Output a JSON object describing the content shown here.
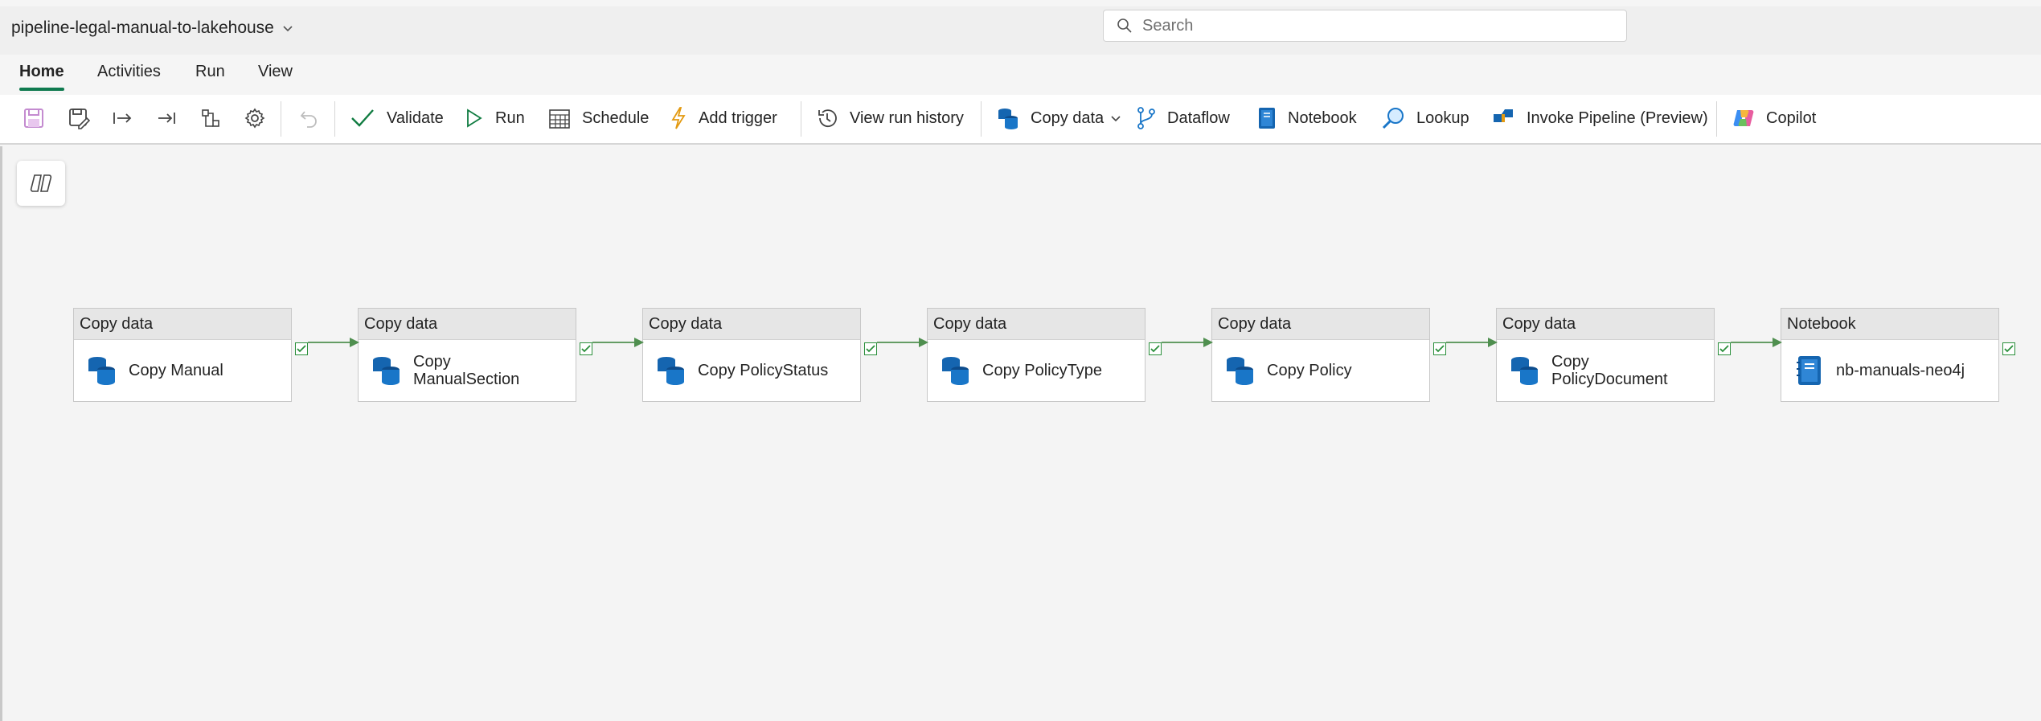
{
  "title": "pipeline-legal-manual-to-lakehouse",
  "search": {
    "placeholder": "Search"
  },
  "tabs": [
    "Home",
    "Activities",
    "Run",
    "View"
  ],
  "toolbar": {
    "validate": "Validate",
    "run": "Run",
    "schedule": "Schedule",
    "add_trigger": "Add trigger",
    "view_run_history": "View run history",
    "copy_data": "Copy data",
    "dataflow": "Dataflow",
    "notebook": "Notebook",
    "lookup": "Lookup",
    "invoke_pipeline": "Invoke Pipeline (Preview)",
    "copilot": "Copilot"
  },
  "activities": [
    {
      "type": "Copy data",
      "name": "Copy Manual",
      "icon": "copy-data-icon"
    },
    {
      "type": "Copy data",
      "name": "Copy ManualSection",
      "icon": "copy-data-icon"
    },
    {
      "type": "Copy data",
      "name": "Copy PolicyStatus",
      "icon": "copy-data-icon"
    },
    {
      "type": "Copy data",
      "name": "Copy PolicyType",
      "icon": "copy-data-icon"
    },
    {
      "type": "Copy data",
      "name": "Copy Policy",
      "icon": "copy-data-icon"
    },
    {
      "type": "Copy data",
      "name": "Copy PolicyDocument",
      "icon": "copy-data-icon"
    },
    {
      "type": "Notebook",
      "name": "nb-manuals-neo4j",
      "icon": "notebook-icon"
    }
  ],
  "colors": {
    "accent": "#0f7a4f",
    "success": "#2a8f3b",
    "connector": "#4f8f4f",
    "icon_blue": "#1565b0"
  }
}
